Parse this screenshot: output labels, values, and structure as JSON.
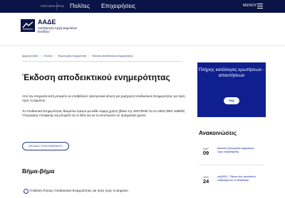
{
  "topnav": {
    "fast_access": "ΓΡΗΓΟΡΗ ΠΡΟΣ",
    "items": [
      "Πολίτες",
      "Επιχειρήσεις"
    ],
    "menu_label": "ΜΕΝΟΥ"
  },
  "logo": {
    "title": "ΑΑΔΕ",
    "subtitle": "Ανεξάρτητη Αρχή Δημοσίων Εσόδων"
  },
  "breadcrumb": [
    "Αρχική σελίδα",
    "Πολίτες",
    "Φορολογική ενημερότητα",
    "Έκδοση αποδεικτικού ενημερότητας"
  ],
  "main": {
    "title": "Έκδοση αποδεικτικού ενημερότητας",
    "paragraph1": "Από την υπηρεσία αυτή μπορείτε να υποβάλλετε ηλεκτρονικά αίτηση για χορήγηση Αποδεικτικού Ενημερότητας για Χρέη προς το Δημόσιο.",
    "paragraph2": "Το Αποδεικτικό Ενημερότητας θεωρείται έγκυρο για κάθε νόμιμη χρήση (βάσει της 2837/0030 /11-11-2003 (ΦΕΚ 1685/Β) Υπουργικής Απόφασης και μπορείτε να το δείτε και να το εκτυπώσετε σε πραγματικό χρόνο.",
    "entry_button": "ΕΙΣΟΔΟΣ ΣΤΗΝ ΕΦΑΡΜΟΓΗ",
    "steps_title": "Βήμα-βήμα",
    "step1": "Υποβολή Αίτησης Αποδεικτικού Ενημερότητας για Χρέη προς το Δημόσιο."
  },
  "sidebar": {
    "faq_title": "Πλήρης κατάλογος ερωτήσεων - απαντήσεων",
    "faq_button": "FAQ",
    "announcements_title": "Ανακοινώσεις",
    "announcements": [
      {
        "month": "ΜΑΡ",
        "day": "09",
        "text": "Διακοπή λειτουργίας εφαρμογών λόγω αναβάθμισης"
      },
      {
        "month": "ΦΕΒ",
        "day": "24",
        "text": "myDATA - Τίθεται νέος προσθετός ανεβαζόμενου το timestamp"
      }
    ]
  }
}
